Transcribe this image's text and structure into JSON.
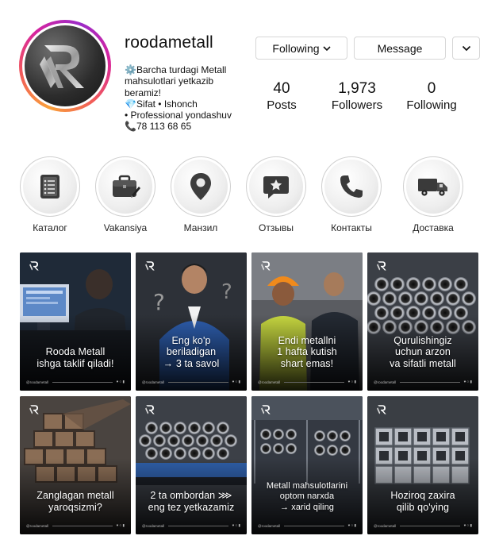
{
  "profile": {
    "username": "roodametall",
    "bio": [
      "⚙️Barcha turdagi Metall",
      "mahsulotlari yetkazib",
      "beramiz!",
      "💎Sifat • Ishonch",
      "• Professional yondashuv",
      "📞78 113 68 65"
    ],
    "avatar_icon": "rooda-r-logo-icon"
  },
  "actions": {
    "following_label": "Following",
    "message_label": "Message"
  },
  "stats": [
    {
      "value": "40",
      "label": "Posts"
    },
    {
      "value": "1,973",
      "label": "Followers"
    },
    {
      "value": "0",
      "label": "Following"
    }
  ],
  "highlights": [
    {
      "label": "Каталог",
      "icon": "catalog-book-icon"
    },
    {
      "label": "Vakansiya",
      "icon": "briefcase-icon"
    },
    {
      "label": "Манзил",
      "icon": "map-pin-icon"
    },
    {
      "label": "Отзывы",
      "icon": "star-chat-icon"
    },
    {
      "label": "Контакты",
      "icon": "phone-icon"
    },
    {
      "label": "Доставка",
      "icon": "delivery-truck-icon"
    }
  ],
  "posts": [
    {
      "lines": [
        "Rooda Metall",
        "ishga taklif qiladi!"
      ],
      "scene": "office-operator",
      "handle": "@roodametall"
    },
    {
      "lines": [
        "Eng ko'p",
        "beriladigan",
        "→ 3 ta savol"
      ],
      "scene": "man-in-suit",
      "handle": "@roodametall"
    },
    {
      "lines": [
        "Endi metallni",
        "1 hafta kutish",
        "shart emas!"
      ],
      "scene": "workers",
      "handle": "@roodametall"
    },
    {
      "lines": [
        "Qurulishingiz",
        "uchun arzon",
        "va sifatli metall"
      ],
      "scene": "pipe-stack",
      "handle": "@roodametall"
    },
    {
      "lines": [
        "Zanglagan metall",
        "yaroqsizmi?"
      ],
      "scene": "rusty-tubes",
      "handle": "@roodametall"
    },
    {
      "lines": [
        "2 ta ombordan ⋙",
        "eng tez yetkazamiz"
      ],
      "scene": "truck-pipes",
      "handle": "@roodametall"
    },
    {
      "lines": [
        "Metall mahsulotlarini",
        "optom narxda",
        "→ xarid qiling"
      ],
      "scene": "warehouse-pipes",
      "handle": "@roodametall"
    },
    {
      "lines": [
        "Hoziroq zaxira",
        "qilib qo'ying"
      ],
      "scene": "square-tubes",
      "handle": "@roodametall"
    }
  ]
}
